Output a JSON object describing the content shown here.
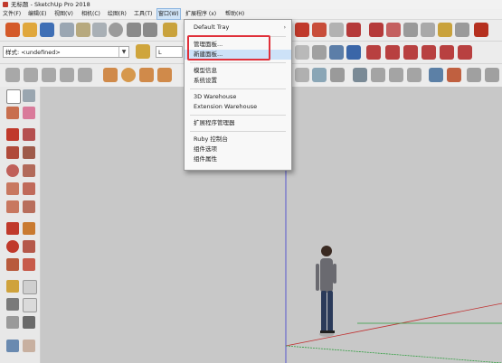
{
  "window": {
    "title": "无标题 - SketchUp Pro 2018"
  },
  "menubar": {
    "items": [
      "文件(F)",
      "编辑(E)",
      "视图(V)",
      "相机(C)",
      "绘图(R)",
      "工具(T)",
      "窗口(W)",
      "扩展程序 (x)",
      "帮助(H)"
    ],
    "active_index": 6
  },
  "toolbar": {
    "style_combo_label": "样式:",
    "style_combo_value": "<undefined>",
    "layer_combo_value": "L"
  },
  "window_menu": {
    "items": [
      {
        "label": "Default Tray",
        "has_submenu": true
      },
      {
        "label": "管理面板..."
      },
      {
        "label": "新建面板...",
        "hovered": true
      },
      {
        "label": "模型信息"
      },
      {
        "label": "系统设置"
      },
      {
        "label": "3D Warehouse"
      },
      {
        "label": "Extension Warehouse"
      },
      {
        "label": "扩展程序管理器"
      },
      {
        "label": "Ruby 控制台"
      },
      {
        "label": "组件选项"
      },
      {
        "label": "组件属性"
      }
    ],
    "submenu_arrow": "›"
  },
  "highlight": {
    "color": "#e0303a"
  },
  "colors": {
    "accent": "#cde2f8",
    "highlight_border": "#e0303a",
    "axis_red": "#c03030",
    "axis_green": "#2e9e3e",
    "axis_blue": "#3a3ad0"
  }
}
